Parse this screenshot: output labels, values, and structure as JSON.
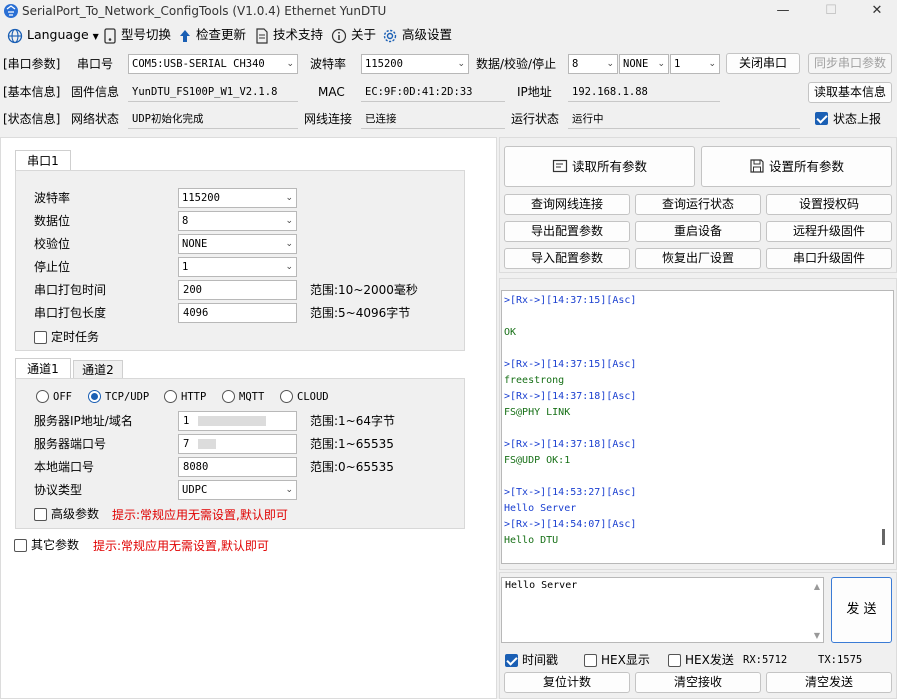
{
  "title": "SerialPort_To_Network_ConfigTools (V1.0.4) Ethernet YunDTU",
  "window_controls": {
    "minimize": "—",
    "maximize": "☐",
    "close": "✕"
  },
  "menu": {
    "language": "Language",
    "model_switch": "型号切换",
    "check_update": "检查更新",
    "tech_support": "技术支持",
    "about": "关于",
    "advanced": "高级设置"
  },
  "row1": {
    "section": "[串口参数]",
    "port_label": "串口号",
    "port_value": "COM5:USB-SERIAL CH340",
    "baud_label": "波特率",
    "baud_value": "115200",
    "dcs_label": "数据/校验/停止",
    "data_bits": "8",
    "parity": "NONE",
    "stop_bits": "1",
    "close_btn": "关闭串口",
    "sync_btn": "同步串口参数"
  },
  "row2": {
    "section": "[基本信息]",
    "fw_label": "固件信息",
    "fw_value": "YunDTU_FS100P_W1_V2.1.8",
    "mac_label": "MAC",
    "mac_value": "EC:9F:0D:41:2D:33",
    "ip_label": "IP地址",
    "ip_value": "192.168.1.88",
    "read_btn": "读取基本信息"
  },
  "row3": {
    "section": "[状态信息]",
    "net_status_label": "网络状态",
    "net_status_value": "UDP初始化完成",
    "link_label": "网线连接",
    "link_value": "已连接",
    "run_label": "运行状态",
    "run_value": "运行中",
    "report_label": "状态上报",
    "report_checked": true
  },
  "serial_tab": {
    "tab": "串口1",
    "baud_label": "波特率",
    "baud_value": "115200",
    "data_label": "数据位",
    "data_value": "8",
    "parity_label": "校验位",
    "parity_value": "NONE",
    "stop_label": "停止位",
    "stop_value": "1",
    "pack_time_label": "串口打包时间",
    "pack_time_value": "200",
    "pack_time_range": "范围:10~2000毫秒",
    "pack_len_label": "串口打包长度",
    "pack_len_value": "4096",
    "pack_len_range": "范围:5~4096字节",
    "timer_label": "定时任务"
  },
  "channel": {
    "tab1": "通道1",
    "tab2": "通道2",
    "modes": [
      "OFF",
      "TCP/UDP",
      "HTTP",
      "MQTT",
      "CLOUD"
    ],
    "selected_mode": "TCP/UDP",
    "server_ip_label": "服务器IP地址/域名",
    "server_ip_value": "1",
    "server_ip_range": "范围:1~64字节",
    "server_port_label": "服务器端口号",
    "server_port_value": "7",
    "server_port_range": "范围:1~65535",
    "local_port_label": "本地端口号",
    "local_port_value": "8080",
    "local_port_range": "范围:0~65535",
    "proto_label": "协议类型",
    "proto_value": "UDPC",
    "adv_label": "高级参数",
    "adv_hint": "提示:常规应用无需设置,默认即可"
  },
  "other": {
    "label": "其它参数",
    "hint": "提示:常规应用无需设置,默认即可"
  },
  "actions": {
    "read_all": "读取所有参数",
    "set_all": "设置所有参数",
    "buttons": [
      [
        "查询网线连接",
        "查询运行状态",
        "设置授权码"
      ],
      [
        "导出配置参数",
        "重启设备",
        "远程升级固件"
      ],
      [
        "导入配置参数",
        "恢复出厂设置",
        "串口升级固件"
      ]
    ]
  },
  "log": [
    {
      "text": ">[Rx->][14:37:15][Asc]",
      "kind": "rx"
    },
    {
      "text": "",
      "kind": "data"
    },
    {
      "text": "OK",
      "kind": "data"
    },
    {
      "text": "",
      "kind": "data"
    },
    {
      "text": ">[Rx->][14:37:15][Asc]",
      "kind": "rx"
    },
    {
      "text": "freestrong",
      "kind": "data"
    },
    {
      "text": ">[Rx->][14:37:18][Asc]",
      "kind": "rx"
    },
    {
      "text": "FS@PHY LINK",
      "kind": "data"
    },
    {
      "text": "",
      "kind": "data"
    },
    {
      "text": ">[Rx->][14:37:18][Asc]",
      "kind": "rx"
    },
    {
      "text": "FS@UDP OK:1",
      "kind": "data"
    },
    {
      "text": "",
      "kind": "data"
    },
    {
      "text": ">[Tx->][14:53:27][Asc]",
      "kind": "tx"
    },
    {
      "text": "Hello Server",
      "kind": "txdata"
    },
    {
      "text": ">[Rx->][14:54:07][Asc]",
      "kind": "rx"
    },
    {
      "text": "Hello DTU",
      "kind": "data"
    }
  ],
  "send": {
    "text": "Hello Server",
    "button": "发 送"
  },
  "bottom": {
    "timestamp_label": "时间戳",
    "timestamp_checked": true,
    "hex_display_label": "HEX显示",
    "hex_send_label": "HEX发送",
    "rx": "RX:5712",
    "tx": "TX:1575",
    "reset_btn": "复位计数",
    "clear_rx_btn": "清空接收",
    "clear_tx_btn": "清空发送"
  },
  "colors": {
    "accent": "#1a5fb4",
    "rx_blue": "#1a3fd0",
    "data_green": "#177017",
    "hint_red": "#e00000"
  }
}
